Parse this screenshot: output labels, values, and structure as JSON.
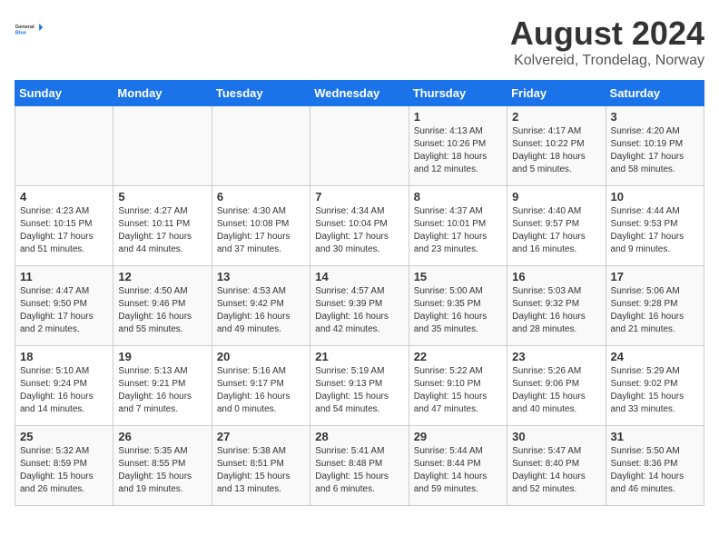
{
  "header": {
    "logo_line1": "General",
    "logo_line2": "Blue",
    "title": "August 2024",
    "subtitle": "Kolvereid, Trondelag, Norway"
  },
  "days_of_week": [
    "Sunday",
    "Monday",
    "Tuesday",
    "Wednesday",
    "Thursday",
    "Friday",
    "Saturday"
  ],
  "weeks": [
    [
      {
        "day": "",
        "info": ""
      },
      {
        "day": "",
        "info": ""
      },
      {
        "day": "",
        "info": ""
      },
      {
        "day": "",
        "info": ""
      },
      {
        "day": "1",
        "info": "Sunrise: 4:13 AM\nSunset: 10:26 PM\nDaylight: 18 hours\nand 12 minutes."
      },
      {
        "day": "2",
        "info": "Sunrise: 4:17 AM\nSunset: 10:22 PM\nDaylight: 18 hours\nand 5 minutes."
      },
      {
        "day": "3",
        "info": "Sunrise: 4:20 AM\nSunset: 10:19 PM\nDaylight: 17 hours\nand 58 minutes."
      }
    ],
    [
      {
        "day": "4",
        "info": "Sunrise: 4:23 AM\nSunset: 10:15 PM\nDaylight: 17 hours\nand 51 minutes."
      },
      {
        "day": "5",
        "info": "Sunrise: 4:27 AM\nSunset: 10:11 PM\nDaylight: 17 hours\nand 44 minutes."
      },
      {
        "day": "6",
        "info": "Sunrise: 4:30 AM\nSunset: 10:08 PM\nDaylight: 17 hours\nand 37 minutes."
      },
      {
        "day": "7",
        "info": "Sunrise: 4:34 AM\nSunset: 10:04 PM\nDaylight: 17 hours\nand 30 minutes."
      },
      {
        "day": "8",
        "info": "Sunrise: 4:37 AM\nSunset: 10:01 PM\nDaylight: 17 hours\nand 23 minutes."
      },
      {
        "day": "9",
        "info": "Sunrise: 4:40 AM\nSunset: 9:57 PM\nDaylight: 17 hours\nand 16 minutes."
      },
      {
        "day": "10",
        "info": "Sunrise: 4:44 AM\nSunset: 9:53 PM\nDaylight: 17 hours\nand 9 minutes."
      }
    ],
    [
      {
        "day": "11",
        "info": "Sunrise: 4:47 AM\nSunset: 9:50 PM\nDaylight: 17 hours\nand 2 minutes."
      },
      {
        "day": "12",
        "info": "Sunrise: 4:50 AM\nSunset: 9:46 PM\nDaylight: 16 hours\nand 55 minutes."
      },
      {
        "day": "13",
        "info": "Sunrise: 4:53 AM\nSunset: 9:42 PM\nDaylight: 16 hours\nand 49 minutes."
      },
      {
        "day": "14",
        "info": "Sunrise: 4:57 AM\nSunset: 9:39 PM\nDaylight: 16 hours\nand 42 minutes."
      },
      {
        "day": "15",
        "info": "Sunrise: 5:00 AM\nSunset: 9:35 PM\nDaylight: 16 hours\nand 35 minutes."
      },
      {
        "day": "16",
        "info": "Sunrise: 5:03 AM\nSunset: 9:32 PM\nDaylight: 16 hours\nand 28 minutes."
      },
      {
        "day": "17",
        "info": "Sunrise: 5:06 AM\nSunset: 9:28 PM\nDaylight: 16 hours\nand 21 minutes."
      }
    ],
    [
      {
        "day": "18",
        "info": "Sunrise: 5:10 AM\nSunset: 9:24 PM\nDaylight: 16 hours\nand 14 minutes."
      },
      {
        "day": "19",
        "info": "Sunrise: 5:13 AM\nSunset: 9:21 PM\nDaylight: 16 hours\nand 7 minutes."
      },
      {
        "day": "20",
        "info": "Sunrise: 5:16 AM\nSunset: 9:17 PM\nDaylight: 16 hours\nand 0 minutes."
      },
      {
        "day": "21",
        "info": "Sunrise: 5:19 AM\nSunset: 9:13 PM\nDaylight: 15 hours\nand 54 minutes."
      },
      {
        "day": "22",
        "info": "Sunrise: 5:22 AM\nSunset: 9:10 PM\nDaylight: 15 hours\nand 47 minutes."
      },
      {
        "day": "23",
        "info": "Sunrise: 5:26 AM\nSunset: 9:06 PM\nDaylight: 15 hours\nand 40 minutes."
      },
      {
        "day": "24",
        "info": "Sunrise: 5:29 AM\nSunset: 9:02 PM\nDaylight: 15 hours\nand 33 minutes."
      }
    ],
    [
      {
        "day": "25",
        "info": "Sunrise: 5:32 AM\nSunset: 8:59 PM\nDaylight: 15 hours\nand 26 minutes."
      },
      {
        "day": "26",
        "info": "Sunrise: 5:35 AM\nSunset: 8:55 PM\nDaylight: 15 hours\nand 19 minutes."
      },
      {
        "day": "27",
        "info": "Sunrise: 5:38 AM\nSunset: 8:51 PM\nDaylight: 15 hours\nand 13 minutes."
      },
      {
        "day": "28",
        "info": "Sunrise: 5:41 AM\nSunset: 8:48 PM\nDaylight: 15 hours\nand 6 minutes."
      },
      {
        "day": "29",
        "info": "Sunrise: 5:44 AM\nSunset: 8:44 PM\nDaylight: 14 hours\nand 59 minutes."
      },
      {
        "day": "30",
        "info": "Sunrise: 5:47 AM\nSunset: 8:40 PM\nDaylight: 14 hours\nand 52 minutes."
      },
      {
        "day": "31",
        "info": "Sunrise: 5:50 AM\nSunset: 8:36 PM\nDaylight: 14 hours\nand 46 minutes."
      }
    ]
  ]
}
